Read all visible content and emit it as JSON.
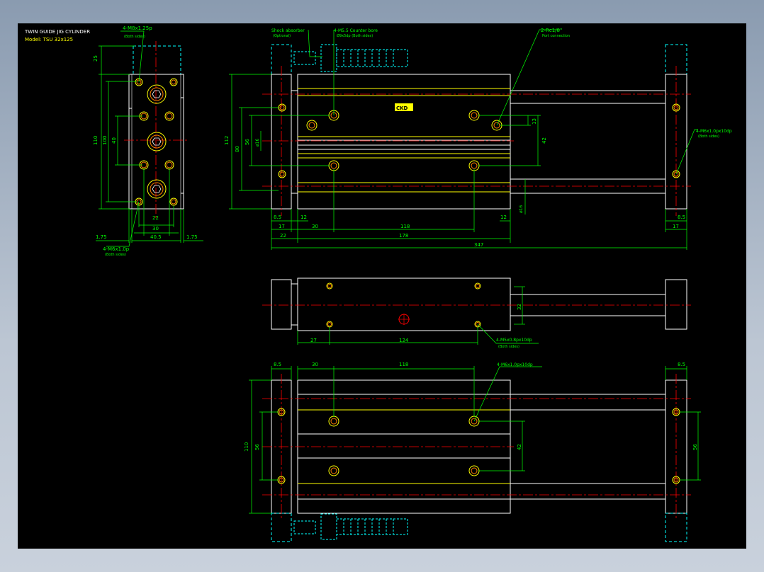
{
  "title_block": {
    "line1": "TWIN GUIDE JIG CYLINDER",
    "line2": "Model: TSU 32x125"
  },
  "colors": {
    "background": "#000000",
    "outline": "#ffffff",
    "dimension": "#00ff00",
    "centerline": "#ff0000",
    "hidden": "#00ffff",
    "hole": "#ff8000",
    "accent": "#ffff00"
  },
  "callouts": {
    "left_top": "4-M8x1.25p",
    "left_top_sub": "(Both sides)",
    "left_bottom": "4-M6x1.0p",
    "left_bottom_sub": "(Both sides)",
    "shock": "Shock absorber",
    "shock_sub": "(Optional)",
    "counter": "4-M5.5 Counter bore",
    "counter_sub": "Ø9x5dp (Both sides)",
    "port": "2-Rc1/8\"",
    "port_sub": "Port connection",
    "right_hole": "4-M6x1.0px10dp",
    "right_hole_sub": "(Both sides)",
    "mid_hole": "4-M5x0.8px10dp",
    "mid_hole_sub": "(Both sides)",
    "bottom_hole": "4-M6x1.0px10dp"
  },
  "dims": {
    "left_25": "25",
    "left_110": "110",
    "left_100": "100",
    "left_40": "40",
    "left_22": "22",
    "left_30": "30",
    "left_405": "40.5",
    "left_175a": "1.75",
    "left_175b": "1.75",
    "top_112": "112",
    "top_80": "80",
    "top_56": "56",
    "top_o16": "ø16",
    "top_13": "13",
    "top_42": "42",
    "top_o16b": "ø16",
    "top_85a": "8.5",
    "top_85b": "8.5",
    "top_12a": "12",
    "top_12b": "12",
    "top_17a": "17",
    "top_17b": "17",
    "top_30": "30",
    "top_118": "118",
    "top_22": "22",
    "top_178": "178",
    "top_347": "347",
    "mid_32": "32",
    "mid_27": "27",
    "mid_124": "124",
    "bot_85a": "8.5",
    "bot_85b": "8.5",
    "bot_30": "30",
    "bot_118": "118",
    "bot_110": "110",
    "bot_56": "56",
    "bot_42": "42",
    "bot_56b": "56"
  },
  "label_plate": "CKD"
}
